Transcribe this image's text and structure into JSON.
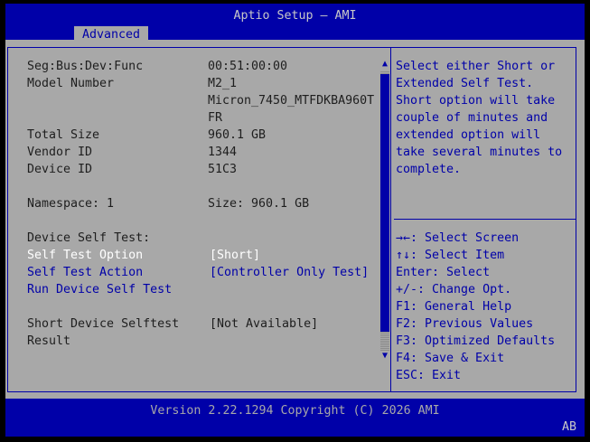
{
  "header": {
    "title": "Aptio Setup – AMI",
    "tab": "Advanced"
  },
  "rows": [
    {
      "label": "Seg:Bus:Dev:Func",
      "value": "00:51:00:00"
    },
    {
      "label": "Model Number",
      "value_lines": [
        "M2_1",
        "Micron_7450_MTFDKBA960T",
        "FR"
      ]
    },
    {
      "label": "Total Size",
      "value": "960.1 GB"
    },
    {
      "label": "Vendor ID",
      "value": "1344"
    },
    {
      "label": "Device ID",
      "value": "51C3"
    },
    {
      "label": "Namespace: 1",
      "value": "Size: 960.1 GB"
    },
    {
      "label": "Device Self Test:"
    },
    {
      "label": "Self Test Option",
      "value": "[Short]"
    },
    {
      "label": "Self Test Action",
      "value": "[Controller Only Test]"
    },
    {
      "label": "Run Device Self Test"
    },
    {
      "label_lines": [
        "Short Device Selftest",
        "Result"
      ],
      "value": "[Not Available]"
    }
  ],
  "help": {
    "description": [
      "Select either Short or",
      "Extended Self Test.",
      "Short option will take",
      "couple of minutes and",
      "extended option will",
      "take several minutes to",
      "complete."
    ],
    "keys": [
      "→←: Select Screen",
      "↑↓: Select Item",
      "Enter: Select",
      "+/-: Change Opt.",
      "F1: General Help",
      "F2: Previous Values",
      "F3: Optimized Defaults",
      "F4: Save & Exit",
      "ESC: Exit"
    ]
  },
  "scrollbar": {
    "up_glyph": "▲",
    "down_glyph": "▼"
  },
  "footer": {
    "version": "Version 2.22.1294 Copyright (C) 2026 AMI",
    "code": "AB"
  },
  "colors": {
    "bar_blue": "#0000a8",
    "panel_gray": "#a8a8a8",
    "selected_white": "#ffffff",
    "text_dark": "#1e1e1e"
  }
}
